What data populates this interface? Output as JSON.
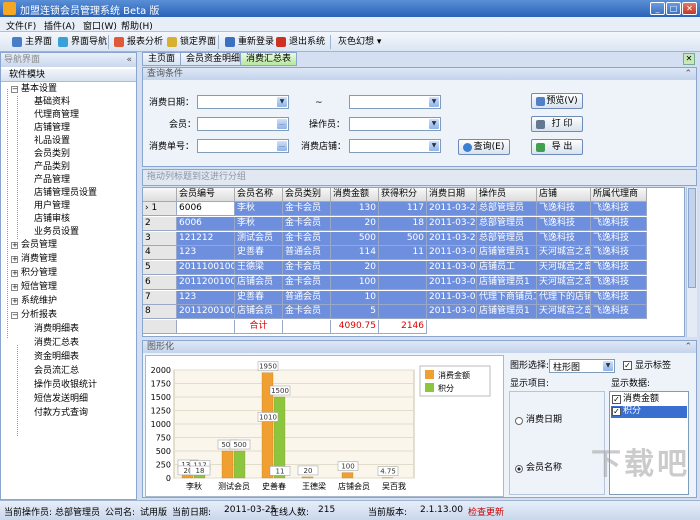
{
  "window": {
    "title": "加盟连锁会员管理系统 Beta 版"
  },
  "menu": [
    "文件(F)",
    "插件(A)",
    "窗口(W)",
    "帮助(H)"
  ],
  "toolbar": {
    "buttons": [
      "主界面",
      "界面导航",
      "报表分析",
      "锁定界面",
      "重新登录",
      "退出系统"
    ],
    "theme": "灰色幻想"
  },
  "nav": {
    "header": "导航界面",
    "module_label": "软件模块",
    "groups": [
      {
        "label": "基本设置",
        "expanded": true,
        "items": [
          "基础资料",
          "代理商管理",
          "店铺管理",
          "礼品设置",
          "会员类别",
          "产品类别",
          "产品管理",
          "店铺管理员设置",
          "用户管理",
          "店铺审核",
          "业务员设置"
        ]
      },
      {
        "label": "会员管理",
        "expanded": false,
        "items": []
      },
      {
        "label": "消费管理",
        "expanded": false,
        "items": []
      },
      {
        "label": "积分管理",
        "expanded": false,
        "items": []
      },
      {
        "label": "短信管理",
        "expanded": false,
        "items": []
      },
      {
        "label": "系统维护",
        "expanded": false,
        "items": []
      },
      {
        "label": "分析报表",
        "expanded": true,
        "items": [
          "消费明细表",
          "消费汇总表",
          "资金明细表",
          "会员流汇总",
          "操作员收银统计",
          "短信发送明细",
          "付款方式查询"
        ]
      }
    ]
  },
  "tabs": [
    "主页面",
    "会员资金明细",
    "消费汇总表"
  ],
  "query": {
    "header": "查询条件",
    "labels": {
      "date": "消费日期：",
      "tilde": "~",
      "member": "会员：",
      "operator": "操作员：",
      "order_no": "消费单号：",
      "store": "消费店铺："
    },
    "buttons": {
      "preview": "预览(V)",
      "print": "打 印",
      "query": "查询(E)",
      "export": "导 出"
    }
  },
  "grid": {
    "group_hint": "拖动列标题到这进行分组",
    "columns": [
      "会员编号",
      "会员名称",
      "会员类别",
      "消费金额",
      "获得积分",
      "消费日期",
      "操作员",
      "店铺",
      "所属代理商"
    ],
    "rows": [
      {
        "rn": "› 1",
        "cells": [
          "6006",
          "李秋",
          "金卡会员",
          "130",
          "117",
          "2011-03-24",
          "总部管理员",
          "飞逸科技",
          "飞逸科技"
        ]
      },
      {
        "rn": "2",
        "cells": [
          "6006",
          "李秋",
          "金卡会员",
          "20",
          "18",
          "2011-03-24",
          "总部管理员",
          "飞逸科技",
          "飞逸科技"
        ]
      },
      {
        "rn": "3",
        "cells": [
          "121212",
          "测试会员",
          "金卡会员",
          "500",
          "500",
          "2011-03-21",
          "总部管理员",
          "飞逸科技",
          "飞逸科技"
        ]
      },
      {
        "rn": "4",
        "cells": [
          "123",
          "史善春",
          "普通会员",
          "114",
          "11",
          "2011-03-08",
          "店铺管理员1",
          "天河城宫之岛",
          "飞逸科技"
        ]
      },
      {
        "rn": "5",
        "cells": [
          "20111001002",
          "王德梁",
          "金卡会员",
          "20",
          "",
          "2011-03-07",
          "店铺员工",
          "天河城宫之岛",
          "飞逸科技"
        ]
      },
      {
        "rn": "6",
        "cells": [
          "20112001001",
          "店铺会员",
          "金卡会员",
          "100",
          "",
          "2011-03-07",
          "店铺管理员1",
          "天河城宫之岛",
          "飞逸科技"
        ]
      },
      {
        "rn": "7",
        "cells": [
          "123",
          "史善春",
          "普通会员",
          "10",
          "",
          "2011-03-07",
          "代理下商铺员工",
          "代理下的店铺",
          "飞逸科技"
        ]
      },
      {
        "rn": "8",
        "cells": [
          "20112001001",
          "店铺会员",
          "金卡会员",
          "5",
          "",
          "2011-03-07",
          "店铺管理员1",
          "天河城宫之岛",
          "飞逸科技"
        ]
      }
    ],
    "total_label": "合计",
    "total_amount": "4090.75",
    "total_points": "2146"
  },
  "graph": {
    "header": "图形化",
    "chart_type_label": "图形选择:",
    "chart_type_value": "柱形图",
    "show_labels": "显示标签",
    "show_items_label": "显示项目:",
    "show_data_label": "显示数据:",
    "radio_items": [
      "消费日期",
      "会员名称"
    ],
    "data_items": [
      "消费金额",
      "积分"
    ]
  },
  "chart_data": {
    "type": "bar",
    "categories": [
      "李秋",
      "测试会员",
      "史善春",
      "王德梁",
      "店铺会员",
      "吴百我"
    ],
    "series": [
      {
        "name": "消费金额",
        "values": [
          150,
          500,
          1950,
          20,
          100,
          4.75
        ]
      },
      {
        "name": "积分",
        "values": [
          135,
          500,
          1500,
          0,
          0,
          0
        ]
      }
    ],
    "data_labels": [
      [
        "130",
        "20",
        "500",
        "1950",
        "1010",
        "20",
        "100",
        "4.75"
      ],
      [
        "117",
        "18",
        "500",
        "1500",
        "11",
        "0",
        "0",
        "0"
      ]
    ],
    "ylim": [
      0,
      2000
    ],
    "yticks": [
      "2000",
      "1750",
      "1500",
      "1250",
      "1000",
      "750",
      "500",
      "250",
      "0"
    ],
    "legend_position": "top-right",
    "colors": {
      "消费金额": "#f0a030",
      "积分": "#8cc63f"
    }
  },
  "status": {
    "operator_label": "当前操作员:",
    "operator": "总部管理员",
    "company_label": "公司名:",
    "company": "试用版",
    "date_label": "当前日期:",
    "date": "2011-03-25",
    "online_label": "在线人数:",
    "online": "215",
    "version_label": "当前版本:",
    "version": "2.1.13.00",
    "update": "检查更新"
  },
  "watermark": "下载吧"
}
